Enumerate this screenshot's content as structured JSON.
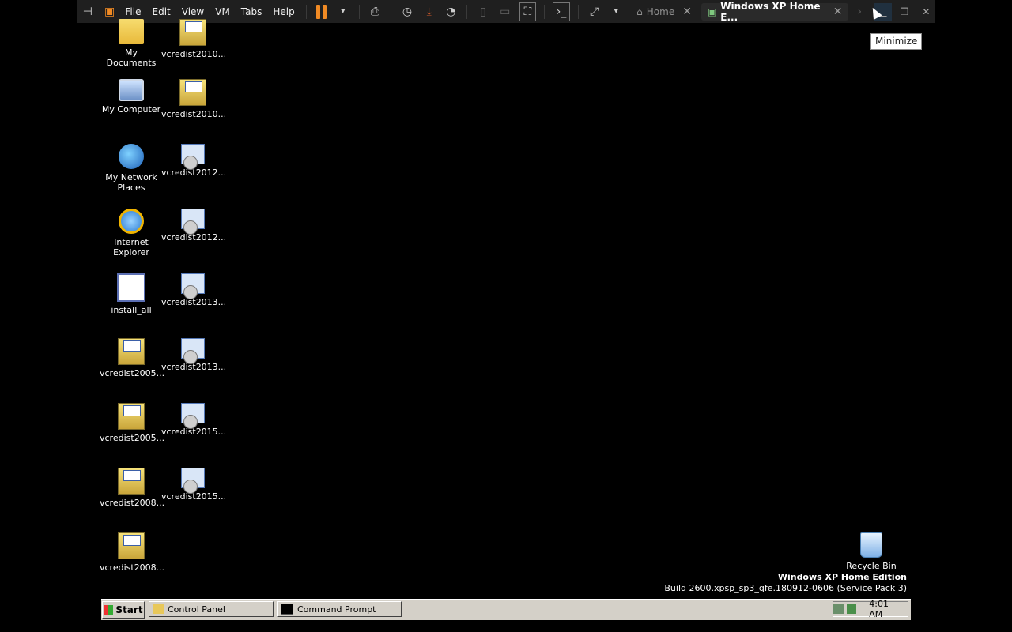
{
  "toolbar": {
    "menus": [
      "File",
      "Edit",
      "View",
      "VM",
      "Tabs",
      "Help"
    ],
    "tabs": [
      {
        "label": "Home",
        "active": false
      },
      {
        "label": "Windows XP Home E...",
        "active": true
      }
    ],
    "tooltip": "Minimize"
  },
  "desktop": {
    "icons_left": [
      {
        "label": "My Documents",
        "icon": "folder"
      },
      {
        "label": "My Computer",
        "icon": "computer"
      },
      {
        "label": "My Network Places",
        "icon": "network"
      },
      {
        "label": "Internet Explorer",
        "icon": "ie"
      },
      {
        "label": "install_all",
        "icon": "setup"
      },
      {
        "label": "vcredist2005...",
        "icon": "installer-box"
      },
      {
        "label": "vcredist2005...",
        "icon": "installer-box"
      },
      {
        "label": "vcredist2008...",
        "icon": "installer-box"
      },
      {
        "label": "vcredist2008...",
        "icon": "installer-box"
      }
    ],
    "icons_right": [
      {
        "label": "vcredist2010...",
        "icon": "installer-box"
      },
      {
        "label": "vcredist2010...",
        "icon": "installer-box"
      },
      {
        "label": "vcredist2012...",
        "icon": "installer-cd"
      },
      {
        "label": "vcredist2012...",
        "icon": "installer-cd"
      },
      {
        "label": "vcredist2013...",
        "icon": "installer-cd"
      },
      {
        "label": "vcredist2013...",
        "icon": "installer-cd"
      },
      {
        "label": "vcredist2015...",
        "icon": "installer-cd"
      },
      {
        "label": "vcredist2015...",
        "icon": "installer-cd"
      }
    ],
    "recycle_bin": "Recycle Bin",
    "os_edition": "Windows XP Home Edition",
    "os_build": "Build 2600.xpsp_sp3_qfe.180912-0606 (Service Pack 3)"
  },
  "taskbar": {
    "start": "Start",
    "tasks": [
      "Control Panel",
      "Command Prompt"
    ],
    "clock": "4:01 AM"
  }
}
